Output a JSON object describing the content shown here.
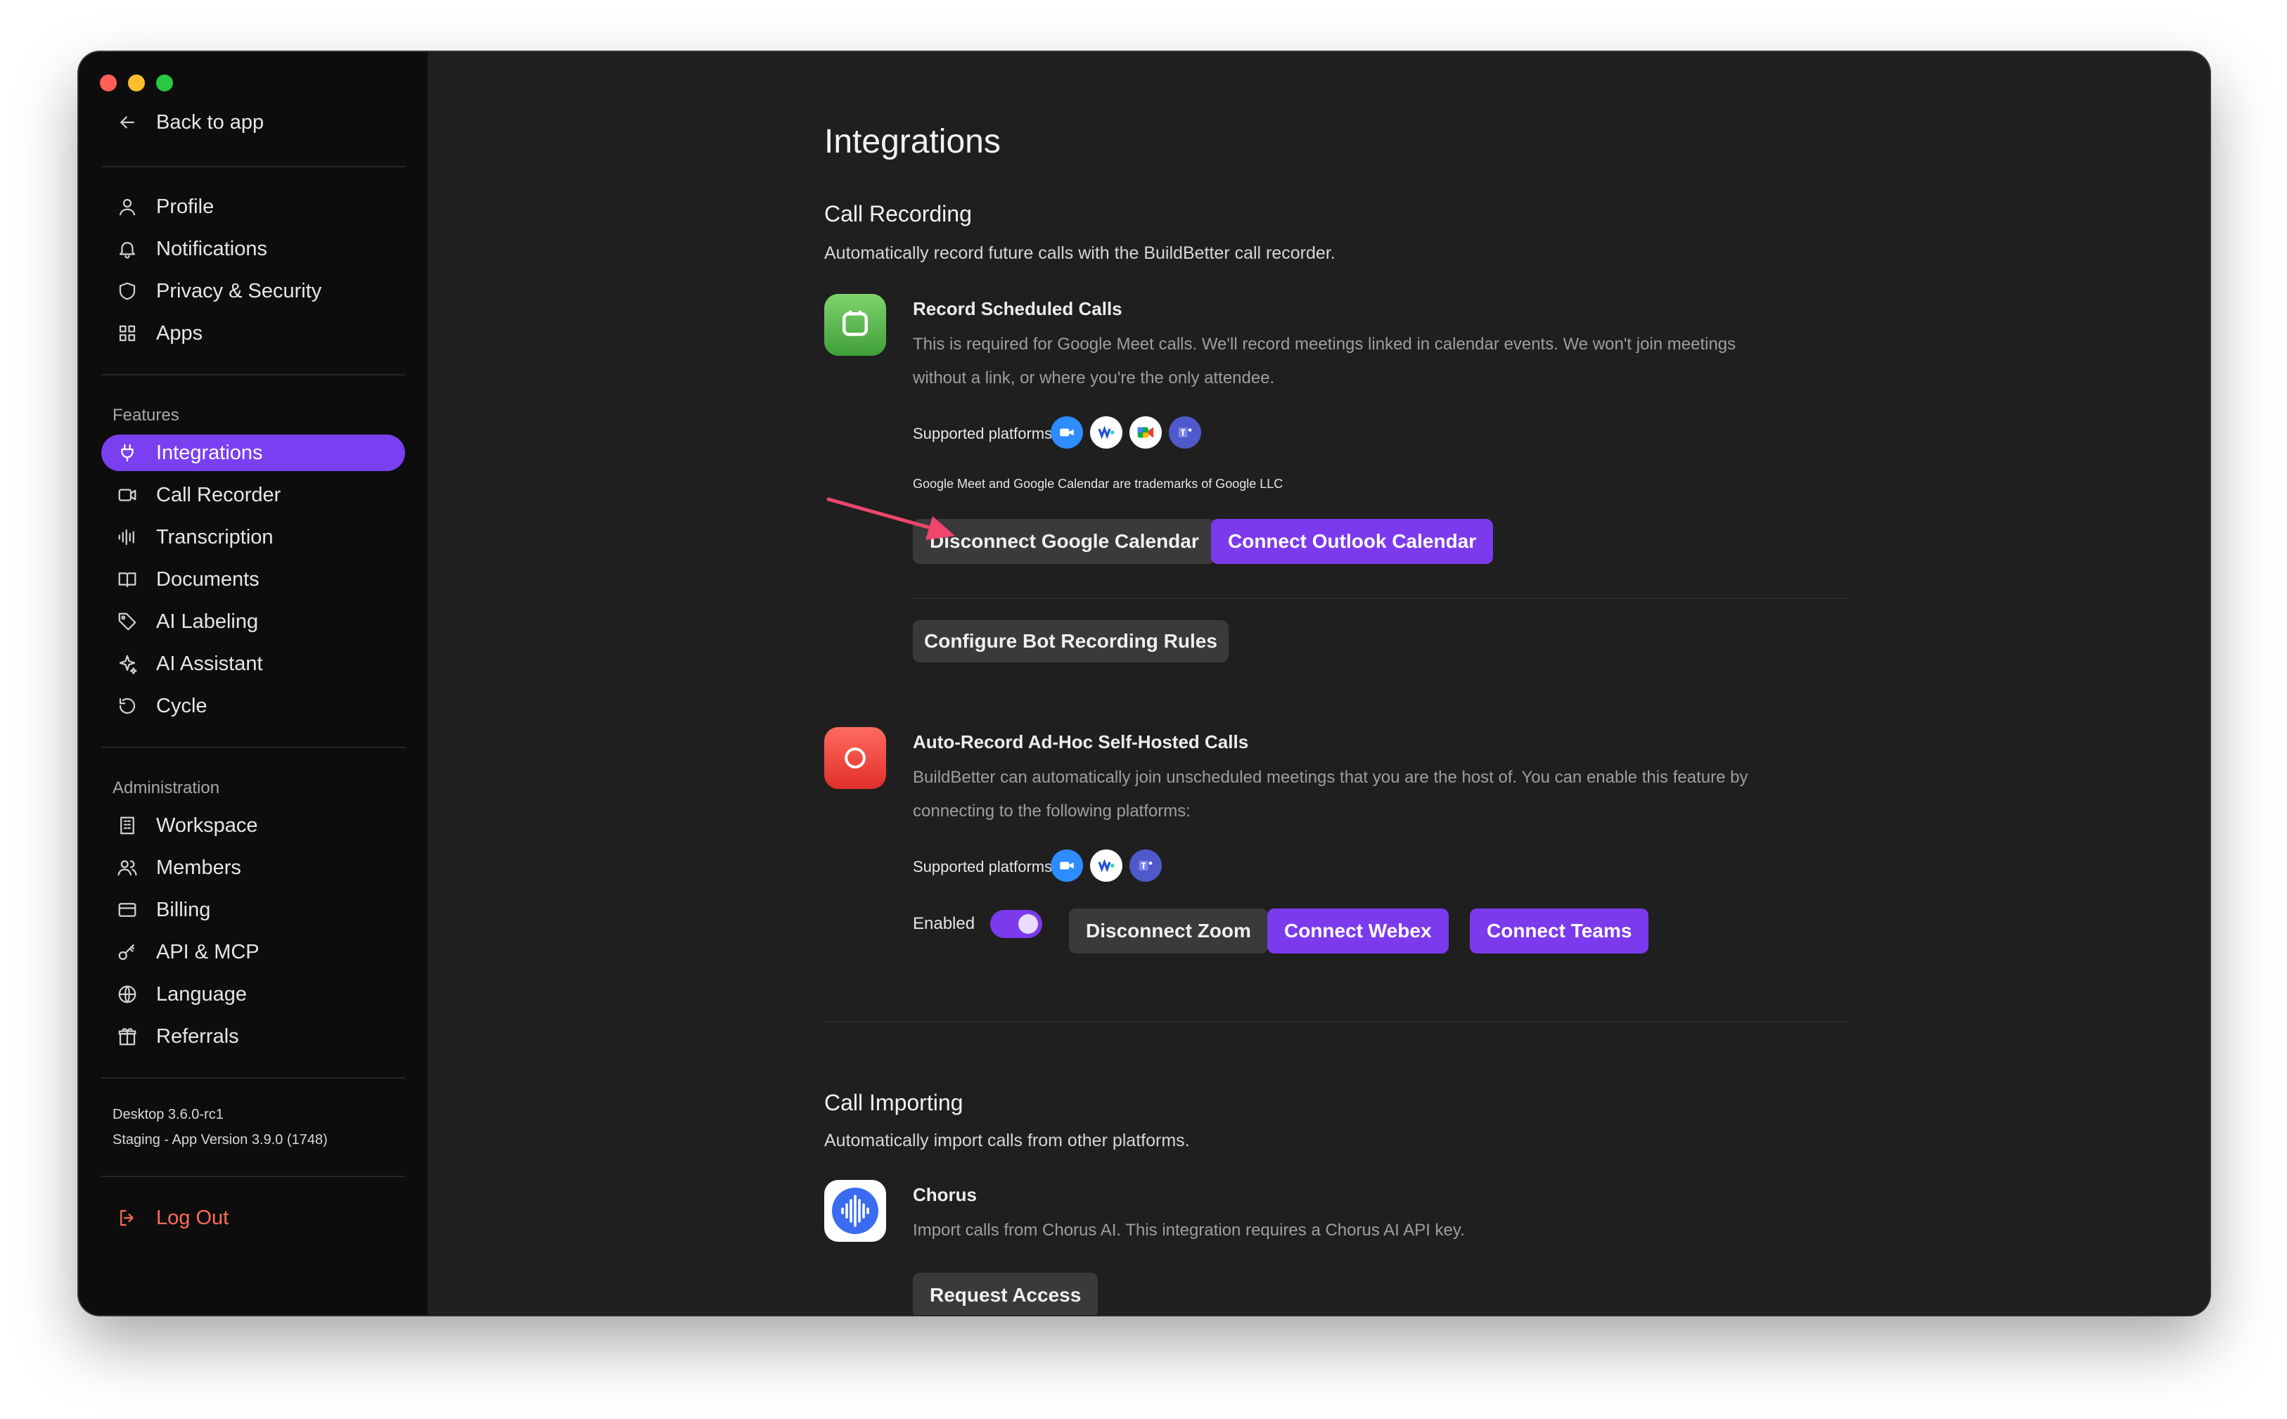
{
  "sidebar": {
    "back": "Back to app",
    "account_items": [
      {
        "label": "Profile",
        "icon": "user-icon"
      },
      {
        "label": "Notifications",
        "icon": "bell-icon"
      },
      {
        "label": "Privacy & Security",
        "icon": "shield-icon"
      },
      {
        "label": "Apps",
        "icon": "grid-icon"
      }
    ],
    "features_heading": "Features",
    "feature_items": [
      {
        "label": "Integrations",
        "icon": "plug-icon",
        "active": true
      },
      {
        "label": "Call Recorder",
        "icon": "video-icon"
      },
      {
        "label": "Transcription",
        "icon": "waveform-icon"
      },
      {
        "label": "Documents",
        "icon": "book-icon"
      },
      {
        "label": "AI Labeling",
        "icon": "tag-icon"
      },
      {
        "label": "AI Assistant",
        "icon": "sparkle-icon"
      },
      {
        "label": "Cycle",
        "icon": "cycle-icon"
      }
    ],
    "admin_heading": "Administration",
    "admin_items": [
      {
        "label": "Workspace",
        "icon": "building-icon"
      },
      {
        "label": "Members",
        "icon": "members-icon"
      },
      {
        "label": "Billing",
        "icon": "card-icon"
      },
      {
        "label": "API & MCP",
        "icon": "key-icon"
      },
      {
        "label": "Language",
        "icon": "globe-icon"
      },
      {
        "label": "Referrals",
        "icon": "gift-icon"
      }
    ],
    "version_line1": "Desktop 3.6.0-rc1",
    "version_line2": "Staging - App Version 3.9.0 (1748)",
    "logout": "Log Out"
  },
  "main": {
    "title": "Integrations",
    "call_recording": {
      "heading": "Call Recording",
      "subtitle": "Automatically record future calls with the BuildBetter call recorder.",
      "scheduled": {
        "title": "Record Scheduled Calls",
        "desc_line1": "This is required for Google Meet calls. We'll record meetings linked in calendar events. We won't join meetings",
        "desc_line2": "without a link, or where you're the only attendee.",
        "platforms_label": "Supported platforms:",
        "platforms": [
          "zoom-icon",
          "webex-icon",
          "google-meet-icon",
          "teams-icon"
        ],
        "trademark": "Google Meet and Google Calendar are trademarks of Google LLC",
        "disconnect_google": "Disconnect Google Calendar",
        "connect_outlook": "Connect Outlook Calendar",
        "configure": "Configure Bot Recording Rules"
      },
      "adhoc": {
        "title": "Auto-Record Ad-Hoc Self-Hosted Calls",
        "desc_line1": "BuildBetter can automatically join unscheduled meetings that you are the host of. You can enable this feature by",
        "desc_line2": "connecting to the following platforms:",
        "platforms_label": "Supported platforms:",
        "platforms": [
          "zoom-icon",
          "webex-icon",
          "teams-icon"
        ],
        "enabled_label": "Enabled",
        "enabled": true,
        "disconnect_zoom": "Disconnect Zoom",
        "connect_webex": "Connect Webex",
        "connect_teams": "Connect Teams"
      }
    },
    "call_importing": {
      "heading": "Call Importing",
      "subtitle": "Automatically import calls from other platforms.",
      "chorus": {
        "title": "Chorus",
        "desc": "Import calls from Chorus AI. This integration requires a Chorus AI API key.",
        "button": "Request Access"
      }
    }
  },
  "colors": {
    "accent": "#7c3aed",
    "annotation_arrow": "#f0466e",
    "logout": "#ff6b57"
  }
}
